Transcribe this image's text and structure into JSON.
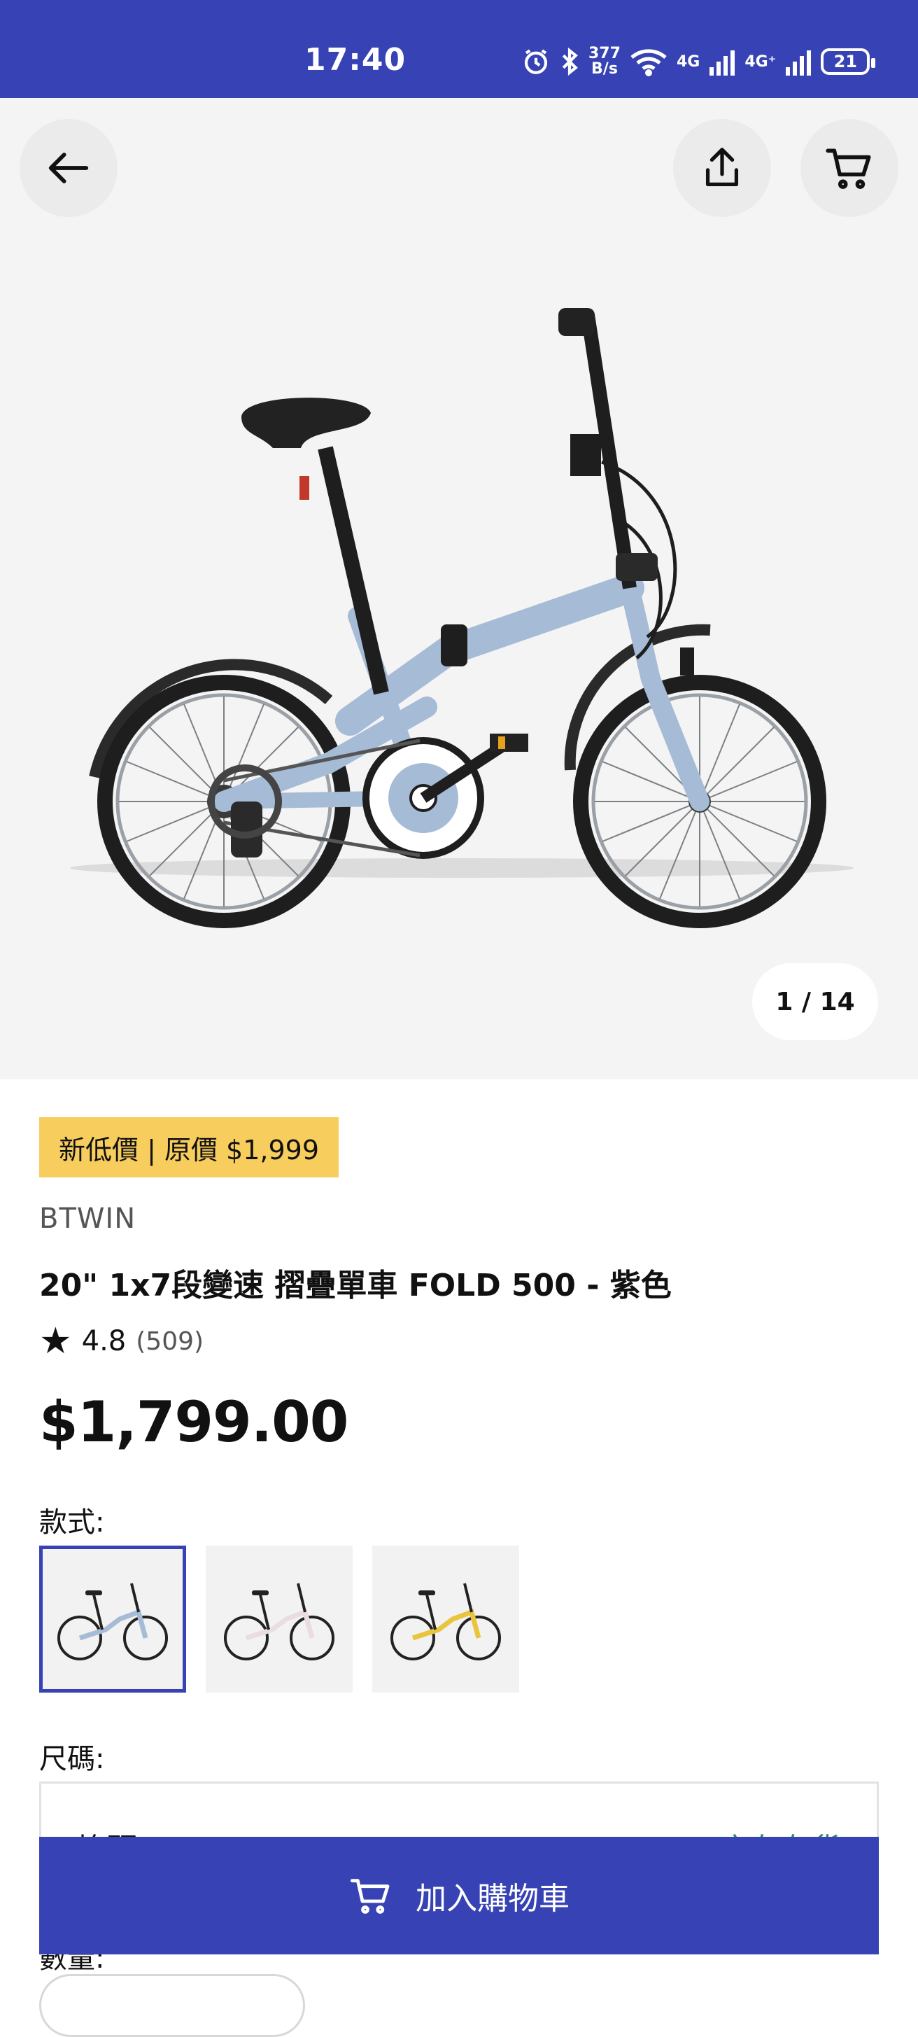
{
  "status_bar": {
    "time": "17:40",
    "network_speed_top": "377",
    "network_speed_bottom": "B/s",
    "signal_1": "4G",
    "signal_2": "4G⁺",
    "battery": "21"
  },
  "gallery": {
    "counter": "1 / 14",
    "current_image": 1,
    "total_images": 14,
    "bike_color": "#a6bbd6"
  },
  "product": {
    "promo_badge": "新低價 | 原價 $1,999",
    "brand": "BTWIN",
    "title": "20\" 1x7段變速 摺疊單車 FOLD 500 - 紫色",
    "rating_star": "★",
    "rating": "4.8",
    "review_count": "(509)",
    "price": "$1,799.00"
  },
  "variants": {
    "label": "款式:",
    "items": [
      {
        "color": "#a6bbd6",
        "selected": true
      },
      {
        "color": "#e9dde0",
        "selected": false
      },
      {
        "color": "#e8c53c",
        "selected": false
      }
    ]
  },
  "size": {
    "label": "尺碼:",
    "value": "均碼",
    "stock": "店存有貨"
  },
  "quantity": {
    "label": "數量:"
  },
  "cta": {
    "add_to_cart": "加入購物車"
  },
  "colors": {
    "brand": "#3743b4",
    "badge": "#f7cd5e",
    "stock_green": "#2d8a5c"
  },
  "icons": {
    "back": "arrow-left-icon",
    "share": "share-icon",
    "cart": "cart-icon"
  }
}
